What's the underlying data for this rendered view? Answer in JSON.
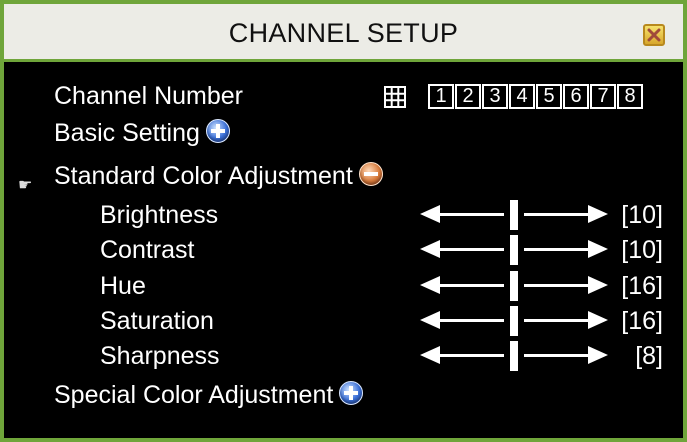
{
  "window": {
    "title": "CHANNEL SETUP"
  },
  "channel_number": {
    "label": "Channel Number",
    "channels": [
      "1",
      "2",
      "3",
      "4",
      "5",
      "6",
      "7",
      "8"
    ]
  },
  "basic_setting": {
    "label": "Basic Setting",
    "icon": "plus-icon"
  },
  "standard_color": {
    "label": "Standard Color Adjustment",
    "icon": "minus-icon",
    "pointer": "hand-pointer-icon"
  },
  "settings": [
    {
      "label": "Brightness",
      "value": "[10]",
      "level": 0.5
    },
    {
      "label": "Contrast",
      "value": "[10]",
      "level": 0.5
    },
    {
      "label": "Hue",
      "value": "[16]",
      "level": 0.5
    },
    {
      "label": "Saturation",
      "value": "[16]",
      "level": 0.5
    },
    {
      "label": "Sharpness",
      "value": "[8]",
      "level": 0.5
    }
  ],
  "special_color": {
    "label": "Special Color Adjustment",
    "icon": "plus-icon"
  },
  "colors": {
    "frame": "#6fa53a",
    "titlebar": "#ecece6",
    "background": "#000000"
  }
}
